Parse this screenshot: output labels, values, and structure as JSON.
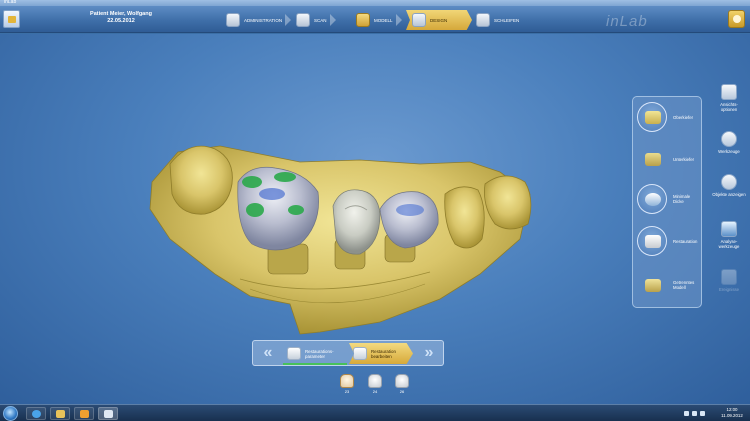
{
  "window": {
    "title": "inLab"
  },
  "header": {
    "patient_name": "Patient Meier, Wolfgang",
    "patient_date": "22.05.2012",
    "brand": "inLab",
    "steps": [
      {
        "label": "ADMINISTRATION",
        "active": false
      },
      {
        "label": "SCAN",
        "active": false
      },
      {
        "label": "MODELL",
        "active": false
      },
      {
        "label": "DESIGN",
        "active": true
      },
      {
        "label": "SCHLEIFEN",
        "active": false
      }
    ]
  },
  "tool_panel": {
    "items": [
      {
        "label": "Oberkiefer",
        "icon": "upper-jaw-icon",
        "ringed": true
      },
      {
        "label": "Unterkiefer",
        "icon": "lower-jaw-icon",
        "ringed": false
      },
      {
        "label": "Minimale Dicke",
        "icon": "minimum-thickness-icon",
        "ringed": true
      },
      {
        "label": "Restauration",
        "icon": "restoration-icon",
        "ringed": true
      },
      {
        "label": "Getrenntes Modell",
        "icon": "separated-model-icon",
        "ringed": false
      }
    ]
  },
  "sidebar": {
    "items": [
      {
        "label": "Ansichts-optionen",
        "icon": "view-options-icon",
        "enabled": true
      },
      {
        "label": "Werkzeuge",
        "icon": "tools-icon",
        "enabled": true
      },
      {
        "label": "Objekte anzeigen",
        "icon": "show-objects-icon",
        "enabled": true
      },
      {
        "label": "Analyse-werkzeuge",
        "icon": "analysis-tools-icon",
        "enabled": true
      },
      {
        "label": "Ereignisse",
        "icon": "events-icon",
        "enabled": false
      }
    ]
  },
  "workflow": {
    "prev_label": "«",
    "next_label": "»",
    "steps": [
      {
        "label": "Restaurations-parameter",
        "active": false
      },
      {
        "label": "Restauration bearbeiten",
        "active": true
      }
    ]
  },
  "teeth": [
    {
      "number": "23",
      "active": true
    },
    {
      "number": "24",
      "active": false
    },
    {
      "number": "26",
      "active": false
    }
  ],
  "taskbar": {
    "apps": [
      "internet-explorer-icon",
      "explorer-icon",
      "media-player-icon",
      "inlab-app-icon"
    ],
    "clock_time": "12:00",
    "clock_date": "11.09.2012"
  },
  "colors": {
    "header_active": "#d6a93a",
    "model_gold": "#d9c56a",
    "crown_gray": "#c9ccc3",
    "contact_green": "#2aa84a",
    "contact_blue": "#4a6fd0",
    "progress_green": "#47c15a"
  }
}
